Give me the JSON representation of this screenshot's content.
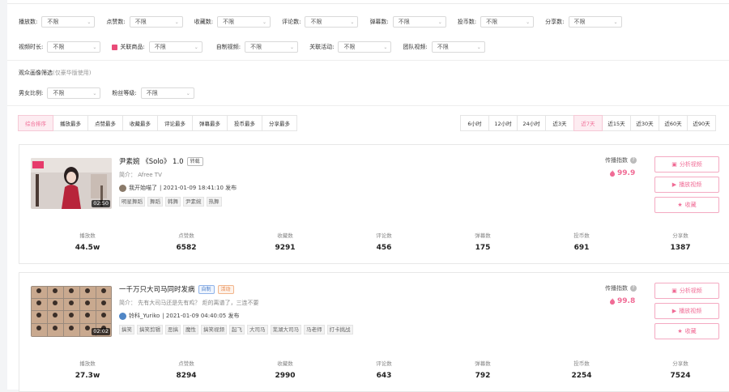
{
  "filters": {
    "row1": [
      {
        "label": "播放数:",
        "value": "不限"
      },
      {
        "label": "点赞数:",
        "value": "不限"
      },
      {
        "label": "收藏数:",
        "value": "不限"
      },
      {
        "label": "评论数:",
        "value": "不限"
      },
      {
        "label": "弹幕数:",
        "value": "不限"
      },
      {
        "label": "投币数:",
        "value": "不限"
      },
      {
        "label": "分享数:",
        "value": "不限"
      }
    ],
    "row2": [
      {
        "label": "视频时长:",
        "value": "不限"
      },
      {
        "label": "关联商品:",
        "value": "不限"
      },
      {
        "label": "自制视频:",
        "value": "不限"
      },
      {
        "label": "关联活动:",
        "value": "不限"
      },
      {
        "label": "团队视频:",
        "value": "不限"
      }
    ],
    "audience_title": "观众画像筛选",
    "audience_note": "(仅豪华版使用)",
    "row3": [
      {
        "label": "男女比例:",
        "value": "不限"
      },
      {
        "label": "粉丝等级:",
        "value": "不限"
      }
    ]
  },
  "sort_tabs": [
    "综合排序",
    "播放最多",
    "点赞最多",
    "收藏最多",
    "评论最多",
    "弹幕最多",
    "投币最多",
    "分享最多"
  ],
  "time_tabs": [
    "6小时",
    "12小时",
    "24小时",
    "近3天",
    "近7天",
    "近15天",
    "近30天",
    "近60天",
    "近90天"
  ],
  "active_sort": "综合排序",
  "active_time": "近7天",
  "accent_color": "#f06b95",
  "videos": [
    {
      "title": "尹素婉 《Solo》 1.0",
      "badges": [
        "转载"
      ],
      "intro": "简介： Afree TV",
      "uploader": "我开始喵了",
      "published": "| 2021-01-09 18:41:10 发布",
      "duration": "02:50",
      "tags": [
        "明星舞蹈",
        "舞蹈",
        "韩舞",
        "尹素婉",
        "热舞"
      ],
      "propagation_label": "传播指数",
      "propagation_value": "99.9",
      "buttons": {
        "analyze": "分析视频",
        "play": "播放视频",
        "collect": "收藏"
      },
      "stats": [
        {
          "label": "播放数",
          "value": "44.5w"
        },
        {
          "label": "点赞数",
          "value": "6582"
        },
        {
          "label": "收藏数",
          "value": "9291"
        },
        {
          "label": "评论数",
          "value": "456"
        },
        {
          "label": "弹幕数",
          "value": "175"
        },
        {
          "label": "投币数",
          "value": "691"
        },
        {
          "label": "分享数",
          "value": "1387"
        }
      ]
    },
    {
      "title": "一千万只大司马同时发病",
      "badges": [
        "自制",
        "活动"
      ],
      "intro": "简介： 先有大司马还是先有鸡？ 炬的离谱了，三连不要",
      "uploader": "铃科_Yuriko",
      "published": "| 2021-01-09 04:40:05 发布",
      "duration": "02:02",
      "tags": [
        "搞笑",
        "搞笑剪辑",
        "恶搞",
        "魔性",
        "搞笑视频",
        "起飞",
        "大司马",
        "芜湖大司马",
        "马老师",
        "打卡挑战"
      ],
      "propagation_label": "传播指数",
      "propagation_value": "99.8",
      "buttons": {
        "analyze": "分析视频",
        "play": "播放视频",
        "collect": "收藏"
      },
      "stats": [
        {
          "label": "播放数",
          "value": "27.3w"
        },
        {
          "label": "点赞数",
          "value": "8294"
        },
        {
          "label": "收藏数",
          "value": "2990"
        },
        {
          "label": "评论数",
          "value": "643"
        },
        {
          "label": "弹幕数",
          "value": "792"
        },
        {
          "label": "投币数",
          "value": "2254"
        },
        {
          "label": "分享数",
          "value": "7524"
        }
      ]
    }
  ]
}
